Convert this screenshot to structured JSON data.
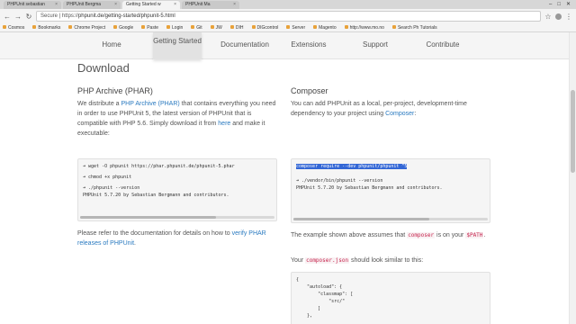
{
  "browser": {
    "tabs": [
      {
        "label": "PHPUnit sebastian"
      },
      {
        "label": "PHPUnit Bergma"
      },
      {
        "label": "Getting Started w"
      },
      {
        "label": "PHPUnit Ma"
      }
    ],
    "close_glyph": "×",
    "address": {
      "host": "Secure | https://",
      "path": "phpunit.de/getting-started/phpunit-5.html"
    },
    "bookmarks": [
      "Cosmos",
      "Bookmarks",
      "Chrome Project",
      "Google",
      "Paste",
      "Login",
      "Git",
      "JW",
      "DIH",
      "DIGcontrol",
      "Server",
      "Magento",
      "http://www.mo.no",
      "Search Ph Tutorials"
    ]
  },
  "site_nav": {
    "items": [
      {
        "label": "Home"
      },
      {
        "label": "Getting Started"
      },
      {
        "label": "Documentation"
      },
      {
        "label": "Extensions"
      },
      {
        "label": "Support"
      },
      {
        "label": "Contribute"
      }
    ]
  },
  "page": {
    "title": "Download",
    "phar": {
      "heading": "PHP Archive (PHAR)",
      "p1_a": "We distribute a ",
      "p1_link": "PHP Archive (PHAR)",
      "p1_b": " that contains everything you need in order to use PHPUnit 5, the latest version of PHPUnit that is compatible with PHP 5.6. Simply download it from ",
      "p1_link2": "here",
      "p1_c": " and make it executable:",
      "code_line1": "➜ wget -O phpunit https://phar.phpunit.de/phpunit-5.phar",
      "code_line2": "➜ chmod +x phpunit",
      "code_line3": "➜ ./phpunit --version",
      "code_line4": "PHPUnit 5.7.20 by Sebastian Bergmann and contributors.",
      "p2_a": "Please refer to the documentation for details on how to ",
      "p2_link": "verify PHAR releases of PHPUnit",
      "p2_b": "."
    },
    "composer": {
      "heading": "Composer",
      "p1_a": "You can add PHPUnit as a local, per-project, development-time dependency to your project using ",
      "p1_link": "Composer",
      "p1_b": ":",
      "code_line1": "composer require --dev phpunit/phpunit ^5",
      "code_line2": "➜ ./vendor/bin/phpunit --version",
      "code_line3": "PHPUnit 5.7.20 by Sebastian Bergmann and contributors.",
      "p2_a": "The example shown above assumes that ",
      "p2_code": "composer",
      "p2_b": " is on your ",
      "p2_code2": "$PATH",
      "p2_c": ".",
      "p3_a": "Your ",
      "p3_code": "composer.json",
      "p3_b": " should look similar to this:",
      "json_lines": [
        "{",
        "    \"autoload\": {",
        "        \"classmap\": [",
        "            \"src/\"",
        "        ]",
        "    },"
      ]
    }
  },
  "colors": {
    "link": "#2a7ac0",
    "selection": "#3367d6"
  },
  "icons": {
    "back": "←",
    "forward": "→",
    "reload": "↻",
    "star": "☆",
    "menu": "⋮"
  }
}
